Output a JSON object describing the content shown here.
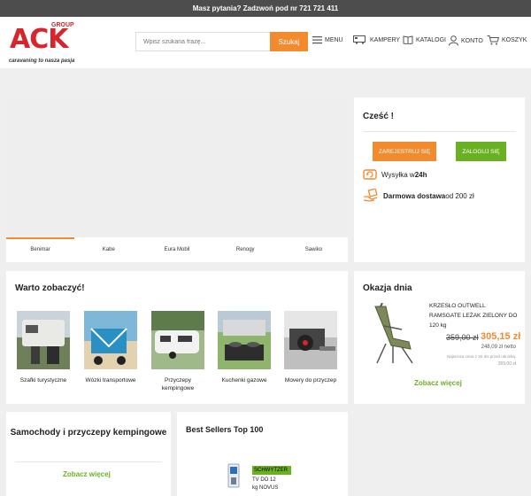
{
  "topbar": {
    "text": "Masz pytania? Zadzwoń pod nr 721 721 411"
  },
  "logo": {
    "group": "GROUP",
    "brand": "ACK",
    "tagline": "caravaning to nasza pasja"
  },
  "search": {
    "placeholder": "Wpisz szukana frazę...",
    "button": "Szukaj"
  },
  "nav": {
    "menu": "MENU",
    "kampery": "KAMPERY",
    "katalogi": "KATALOGI",
    "konto": "KONTO",
    "koszyk": "KOSZYK"
  },
  "brands": [
    "Benimar",
    "Kabe",
    "Eura Mobil",
    "Renogy",
    "Sawiko"
  ],
  "hello": {
    "title": "Cześć !",
    "register": "ZAREJESTRUJ SIĘ",
    "login": "ZALOGUJ SIĘ",
    "shipping_prefix": "Wysyłka w ",
    "shipping_bold": "24h",
    "free_bold": "Darmowa dostawa",
    "free_rest": " od 200 zł"
  },
  "warto": {
    "title": "Warto zobaczyć!",
    "tiles": [
      {
        "label": "Szafki turystyczne"
      },
      {
        "label": "Wózki transportowe"
      },
      {
        "label": "Przyczepy kempingowe"
      },
      {
        "label": "Kuchenki gazowe"
      },
      {
        "label": "Movery do przyczep"
      }
    ]
  },
  "okazja": {
    "title": "Okazja dnia",
    "product": "KRZESŁO OUTWELL RAMSGATE LEŻAK ZIELONY DO 120 kg",
    "old_price": "359,00 zł",
    "new_price": "305,15 zł",
    "netto": "248,09 zł netto",
    "lowest_note": "Najniższa cena z 30 dni przed obniżką:",
    "lowest_value": "359,00 zł",
    "more": "Zobacz więcej"
  },
  "samochody": {
    "title": "Samochody i przyczepy kempingowe",
    "more": "Zobacz więcej"
  },
  "bestsellers": {
    "title": "Best Sellers Top 100",
    "badge": "SCHWYTZER",
    "product_line1": "TV DO 12",
    "product_line2": "kg NOVUS"
  },
  "colors": {
    "accent": "#f28a2e",
    "green": "#6ab023",
    "brand_red": "#d8242b"
  }
}
